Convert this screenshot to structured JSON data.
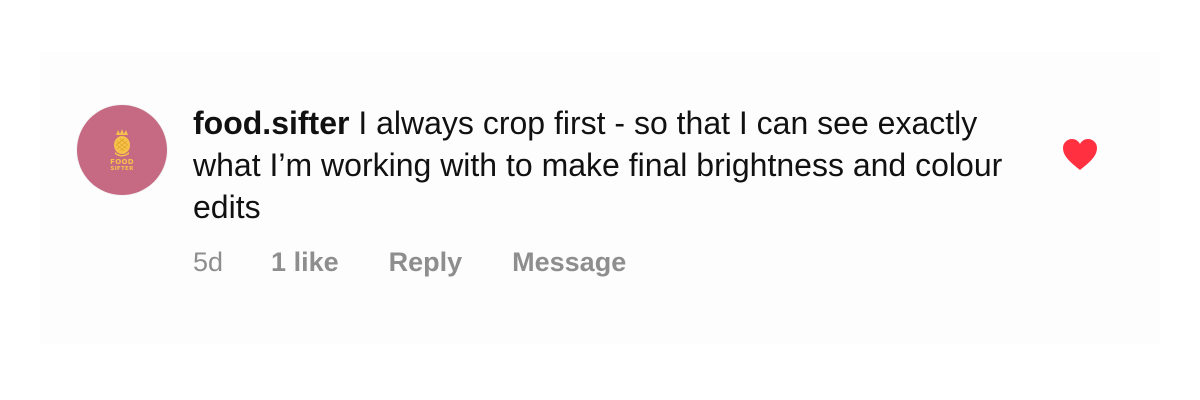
{
  "comment": {
    "username": "food.sifter",
    "text": "I always crop first - so that I can see exactly what I’m working with to make final brightness and colour edits"
  },
  "avatar": {
    "brand_line1": "FOOD",
    "brand_line2": "SIFTER",
    "background": "#c56a82",
    "accent": "#f6c24a"
  },
  "meta": {
    "time": "5d",
    "likes": "1 like",
    "reply": "Reply",
    "message": "Message"
  },
  "like_icon": {
    "name": "heart-icon",
    "state": "liked",
    "color": "#ff3040"
  }
}
